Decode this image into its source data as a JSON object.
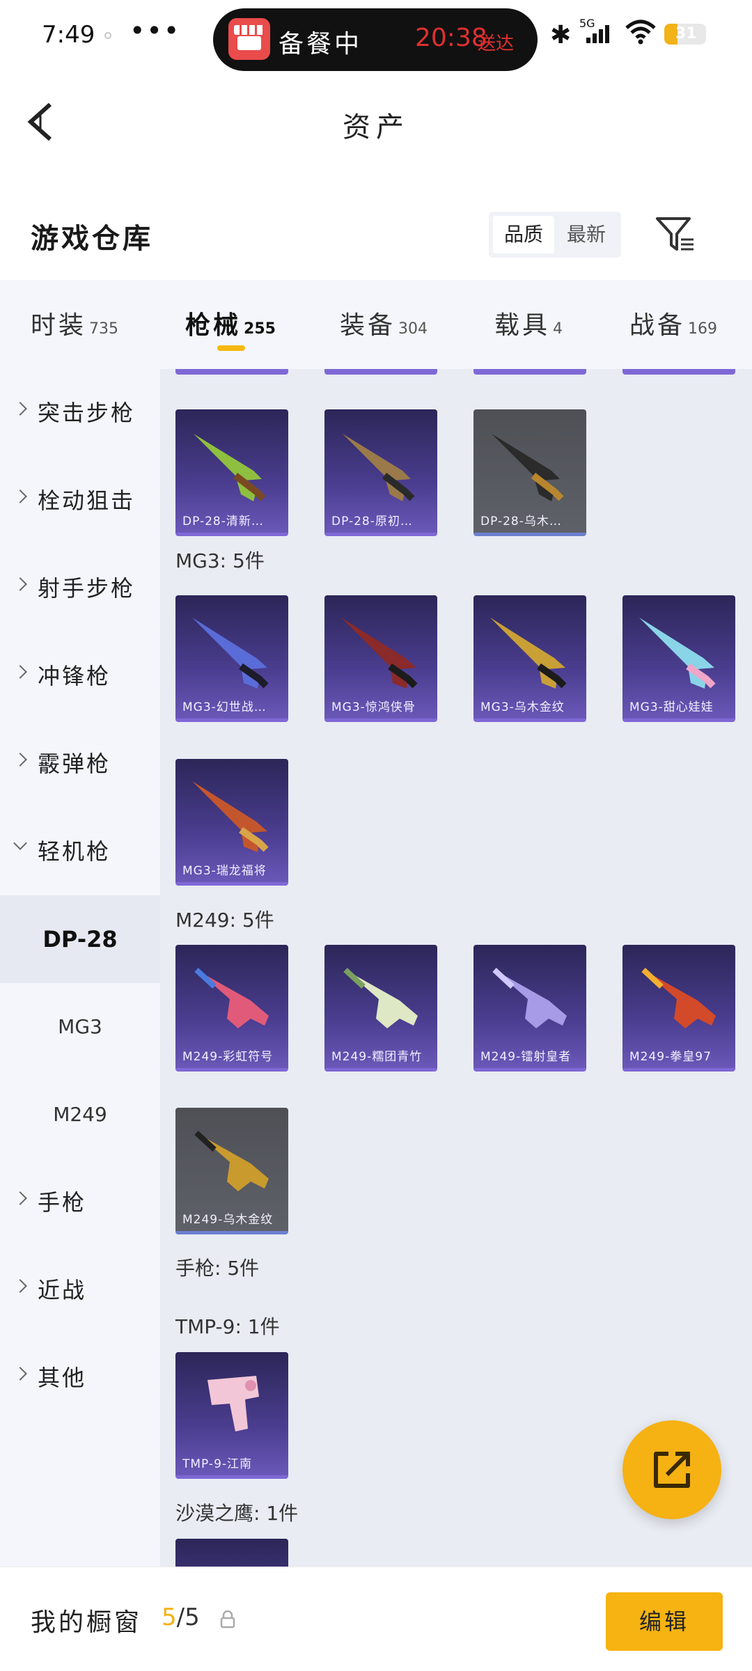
{
  "status_bar": {
    "time": "7:49",
    "more": "•••",
    "island_status": "备餐中",
    "island_eta": "20:38",
    "island_eta_suffix": "送达",
    "network": "5G",
    "battery": "31",
    "battery_level": 0.31,
    "accent_color": "#f2b318"
  },
  "header": {
    "title": "资产"
  },
  "section": {
    "title": "游戏仓库",
    "sort_options": [
      "品质",
      "最新"
    ]
  },
  "tabs": [
    {
      "label": "时装",
      "count": "735"
    },
    {
      "label": "枪械",
      "count": "255"
    },
    {
      "label": "装备",
      "count": "304"
    },
    {
      "label": "载具",
      "count": "4"
    },
    {
      "label": "战备",
      "count": "169"
    }
  ],
  "sidebar": {
    "items": [
      "突击步枪",
      "栓动狙击",
      "射手步枪",
      "冲锋枪",
      "霰弹枪",
      "轻机枪"
    ],
    "subitems": [
      "DP-28",
      "MG3",
      "M249"
    ],
    "items_after": [
      "手枪",
      "近战",
      "其他"
    ]
  },
  "groups": {
    "dp28": [
      "DP-28-清新…",
      "DP-28-原初…",
      "DP-28-乌木…"
    ],
    "mg3_label": "MG3: 5件",
    "mg3": [
      "MG3-幻世战…",
      "MG3-惊鸿侠骨",
      "MG3-乌木金纹",
      "MG3-甜心娃娃",
      "MG3-瑞龙福将"
    ],
    "m249_label": "M249: 5件",
    "m249": [
      "M249-彩虹符号",
      "M249-糯团青竹",
      "M249-镭射皇者",
      "M249-拳皇97",
      "M249-乌木金纹"
    ],
    "pistol_label": "手枪: 5件",
    "tmp9_label": "TMP-9: 1件",
    "tmp9": [
      "TMP-9-江南"
    ],
    "deagle_label": "沙漠之鹰: 1件"
  },
  "bottom_bar": {
    "label": "我的橱窗",
    "used": "5",
    "total": "/5",
    "edit": "编辑"
  },
  "colors": {
    "accent": "#f5b80f",
    "card_purple": "#4a3d8f",
    "card_grey": "#5e6168"
  }
}
